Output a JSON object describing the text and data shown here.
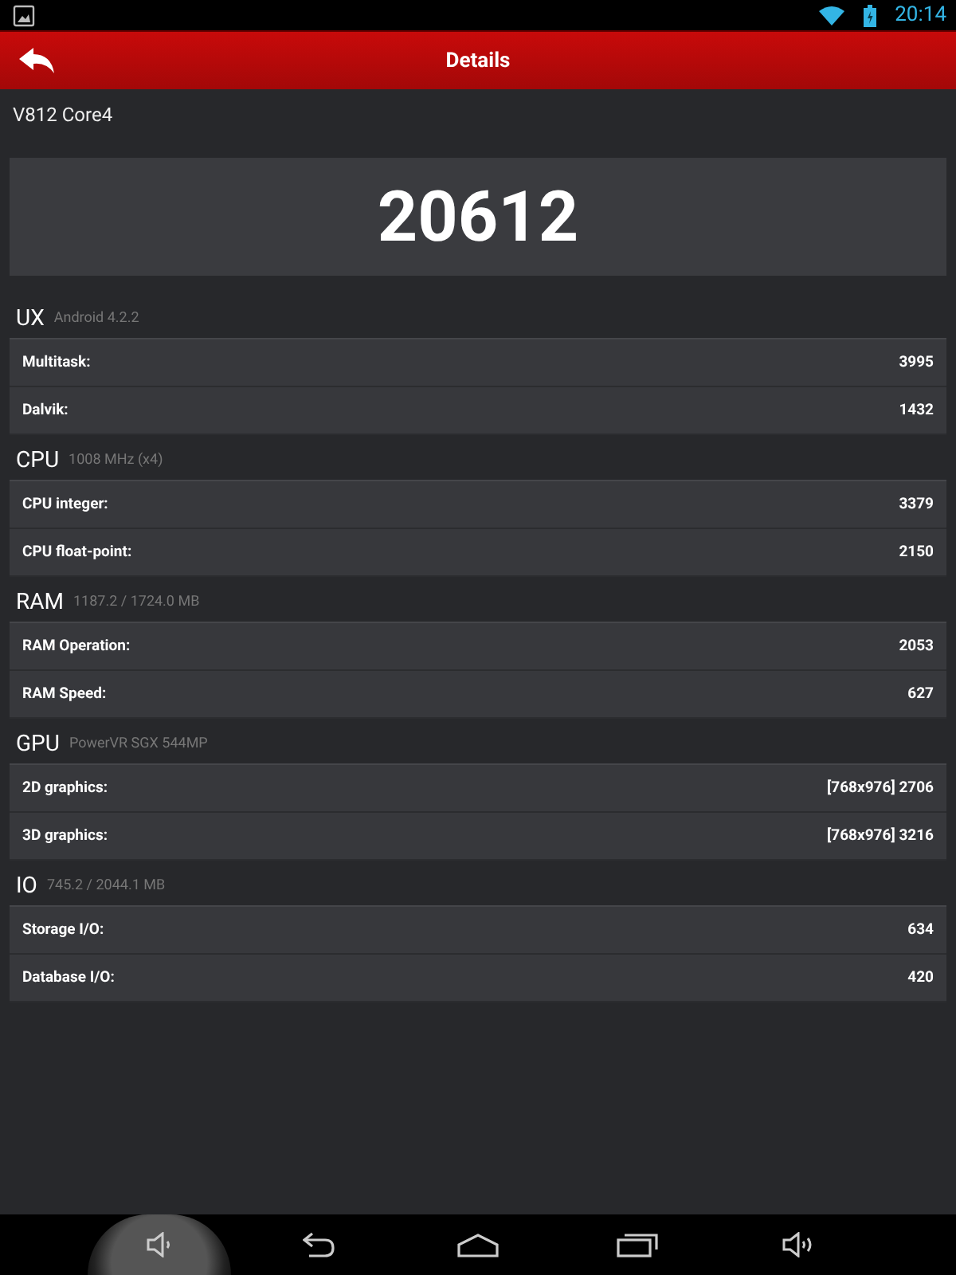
{
  "status_bar": {
    "time": "20:14"
  },
  "header": {
    "title": "Details"
  },
  "device": "V812 Core4",
  "score": "20612",
  "sections": [
    {
      "title": "UX",
      "subtitle": "Android 4.2.2",
      "rows": [
        {
          "label": "Multitask:",
          "value": "3995"
        },
        {
          "label": "Dalvik:",
          "value": "1432"
        }
      ]
    },
    {
      "title": "CPU",
      "subtitle": "1008 MHz (x4)",
      "rows": [
        {
          "label": "CPU integer:",
          "value": "3379"
        },
        {
          "label": "CPU float-point:",
          "value": "2150"
        }
      ]
    },
    {
      "title": "RAM",
      "subtitle": "1187.2 / 1724.0 MB",
      "rows": [
        {
          "label": "RAM Operation:",
          "value": "2053"
        },
        {
          "label": "RAM Speed:",
          "value": "627"
        }
      ]
    },
    {
      "title": "GPU",
      "subtitle": "PowerVR SGX 544MP",
      "rows": [
        {
          "label": "2D graphics:",
          "value": "[768x976] 2706"
        },
        {
          "label": "3D graphics:",
          "value": "[768x976] 3216"
        }
      ]
    },
    {
      "title": "IO",
      "subtitle": "745.2 / 2044.1 MB",
      "rows": [
        {
          "label": "Storage I/O:",
          "value": "634"
        },
        {
          "label": "Database I/O:",
          "value": "420"
        }
      ]
    }
  ],
  "nav_buttons": [
    {
      "kind": "volume_down",
      "pressed": true
    },
    {
      "kind": "back",
      "pressed": false
    },
    {
      "kind": "home",
      "pressed": false
    },
    {
      "kind": "recents",
      "pressed": false
    },
    {
      "kind": "volume_up",
      "pressed": false
    }
  ]
}
